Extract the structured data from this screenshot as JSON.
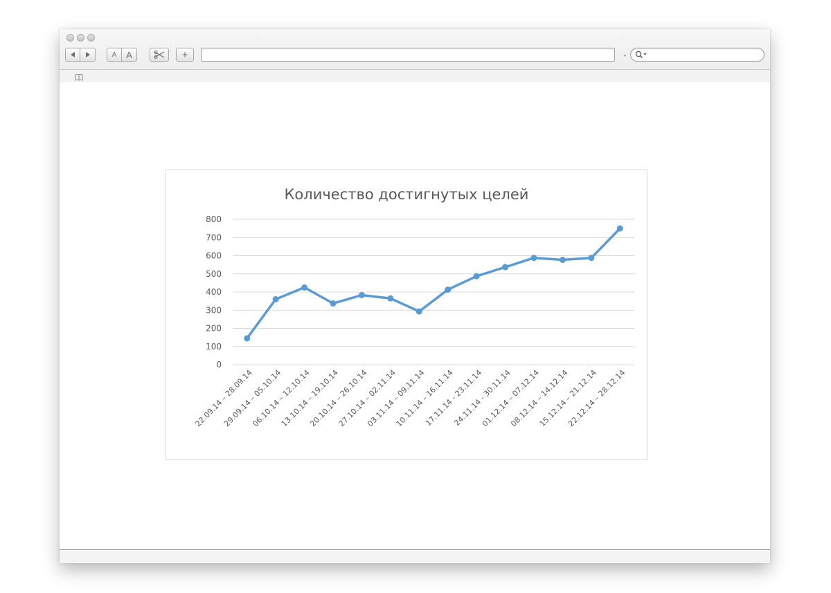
{
  "window": {
    "address_value": "",
    "search_placeholder": ""
  },
  "toolbar": {
    "text_smaller_label": "A",
    "text_larger_label": "A",
    "add_label": "+"
  },
  "icons": {
    "back": "back-arrow-icon",
    "forward": "forward-arrow-icon",
    "clip": "web-clip-icon",
    "search": "search-icon",
    "bookmarks": "bookmarks-book-icon"
  },
  "colors": {
    "series": "#5b9bd5",
    "gridline": "#d9d9d9",
    "text": "#595959"
  },
  "chart_data": {
    "type": "line",
    "title": "Количество достигнутых целей",
    "xlabel": "",
    "ylabel": "",
    "ylim": [
      0,
      800
    ],
    "yticks": [
      0,
      100,
      200,
      300,
      400,
      500,
      600,
      700,
      800
    ],
    "grid": true,
    "legend": "none",
    "categories": [
      "22.09.14 – 28.09.14",
      "29.09.14 – 05.10.14",
      "06.10.14 – 12.10.14",
      "13.10.14 – 19.10.14",
      "20.10.14 – 26.10.14",
      "27.10.14 – 02.11.14",
      "03.11.14 – 09.11.14",
      "10.11.14 – 16.11.14",
      "17.11.14 - 23.11.14",
      "24.11.14 - 30.11.14",
      "01.12.14 – 07.12.14",
      "08.12.14 – 14.12.14",
      "15.12.14 – 21.12.14",
      "22.12.14 – 28.12.14"
    ],
    "series": [
      {
        "values": [
          145,
          360,
          425,
          337,
          383,
          365,
          293,
          413,
          487,
          537,
          588,
          577,
          588,
          750
        ]
      }
    ]
  }
}
